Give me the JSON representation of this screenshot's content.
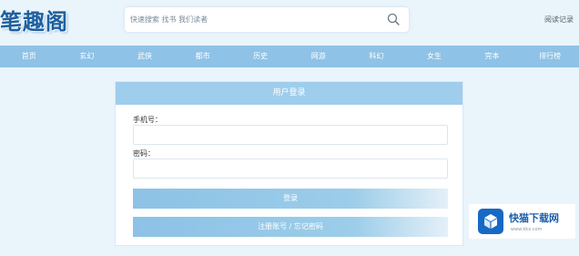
{
  "header": {
    "logo_text": "笔趣阁",
    "search_placeholder": "快速搜索  找书  我们读者",
    "history_link": "阅读记录"
  },
  "nav": {
    "items": [
      "首页",
      "玄幻",
      "武侠",
      "都市",
      "历史",
      "网游",
      "科幻",
      "女生",
      "完本",
      "排行榜"
    ]
  },
  "login": {
    "title": "用户登录",
    "phone_label": "手机号：",
    "phone_value": "",
    "password_label": "密码：",
    "password_value": "",
    "submit_label": "登录",
    "register_label": "注册账号 / 忘记密码"
  },
  "watermark": {
    "title": "快猫下载网",
    "url": "www.kkx.com"
  },
  "colors": {
    "accent": "#8ec2e6",
    "logo": "#1f5f9e",
    "background": "#eaf4fb"
  }
}
